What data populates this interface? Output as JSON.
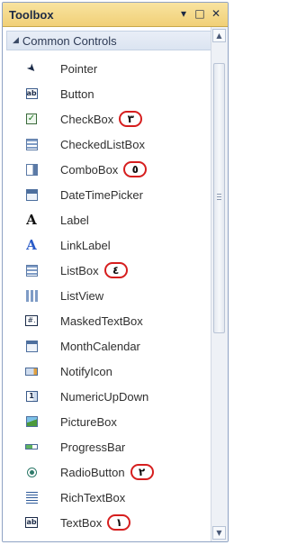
{
  "window": {
    "title": "Toolbox",
    "buttons": {
      "dropdown": "▾",
      "maximize": "□",
      "close": "✕"
    }
  },
  "group": {
    "label": "Common Controls",
    "expand_glyph": "◢"
  },
  "items": [
    {
      "label": "Pointer",
      "icon": "pointer-icon",
      "glyph": "➤"
    },
    {
      "label": "Button",
      "icon": "button-icon",
      "glyph": "ab"
    },
    {
      "label": "CheckBox",
      "icon": "checkbox-icon",
      "glyph": "✓",
      "badge": "٣"
    },
    {
      "label": "CheckedListBox",
      "icon": "checkedlistbox-icon",
      "glyph": ""
    },
    {
      "label": "ComboBox",
      "icon": "combobox-icon",
      "glyph": "",
      "badge": "٥"
    },
    {
      "label": "DateTimePicker",
      "icon": "datetimepicker-icon",
      "glyph": ""
    },
    {
      "label": "Label",
      "icon": "label-icon",
      "glyph": "A"
    },
    {
      "label": "LinkLabel",
      "icon": "linklabel-icon",
      "glyph": "A"
    },
    {
      "label": "ListBox",
      "icon": "listbox-icon",
      "glyph": "",
      "badge": "٤"
    },
    {
      "label": "ListView",
      "icon": "listview-icon",
      "glyph": ""
    },
    {
      "label": "MaskedTextBox",
      "icon": "maskedtextbox-icon",
      "glyph": "#."
    },
    {
      "label": "MonthCalendar",
      "icon": "monthcalendar-icon",
      "glyph": ""
    },
    {
      "label": "NotifyIcon",
      "icon": "notifyicon-icon",
      "glyph": ""
    },
    {
      "label": "NumericUpDown",
      "icon": "numericupdown-icon",
      "glyph": "1"
    },
    {
      "label": "PictureBox",
      "icon": "picturebox-icon",
      "glyph": ""
    },
    {
      "label": "ProgressBar",
      "icon": "progressbar-icon",
      "glyph": ""
    },
    {
      "label": "RadioButton",
      "icon": "radiobutton-icon",
      "glyph": "",
      "badge": "٢"
    },
    {
      "label": "RichTextBox",
      "icon": "richtextbox-icon",
      "glyph": ""
    },
    {
      "label": "TextBox",
      "icon": "textbox-icon",
      "glyph": "ab",
      "badge": "١"
    }
  ],
  "scrollbar": {
    "up": "▲",
    "down": "▼"
  },
  "colors": {
    "title_bar": "#f1d077",
    "badge_ring": "#d61e1e"
  }
}
